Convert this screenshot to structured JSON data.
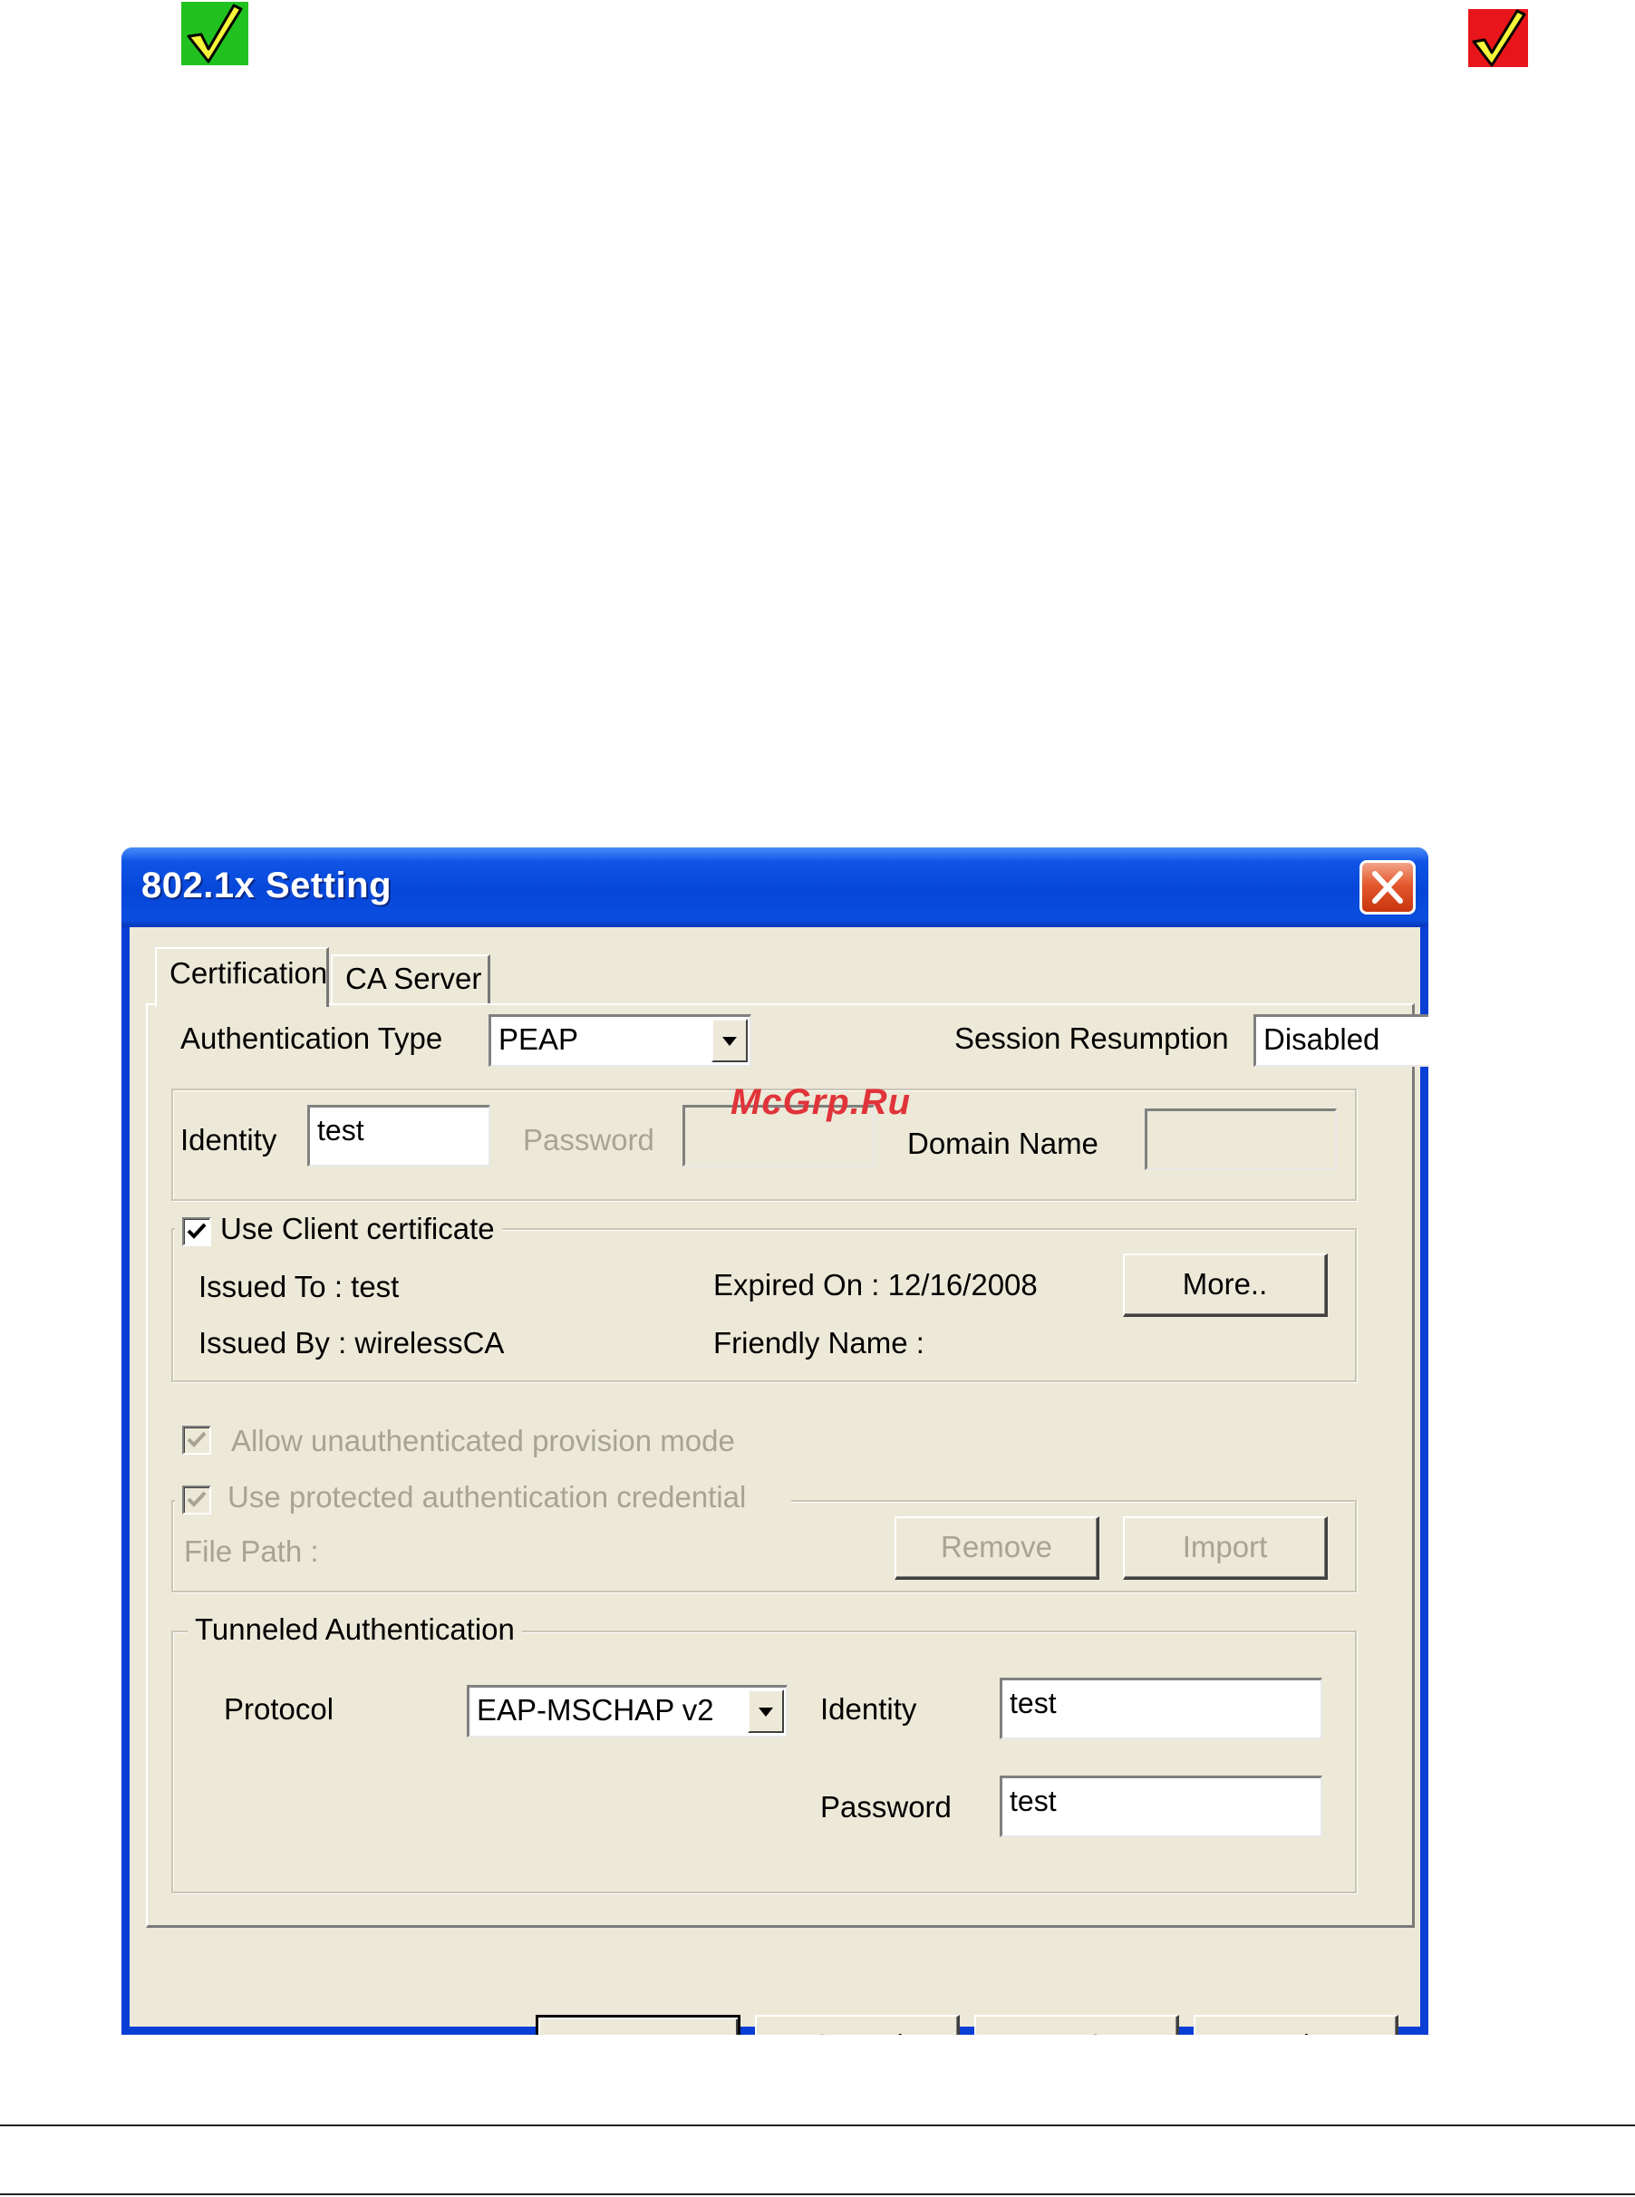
{
  "decorations": {
    "green_check_icon": "check-icon",
    "red_check_icon": "check-icon",
    "green_color": "#21c21f",
    "red_color": "#e8161a",
    "watermark": "McGrp.Ru"
  },
  "dialog": {
    "title": "802.1x Setting",
    "close_icon": "close-icon",
    "tabs": [
      {
        "label": "Certification",
        "selected": true
      },
      {
        "label": "CA Server",
        "selected": false
      }
    ],
    "authentication_type": {
      "label": "Authentication Type",
      "value": "PEAP"
    },
    "session_resumption": {
      "label": "Session Resumption",
      "value": "Disabled"
    },
    "identity": {
      "label": "Identity",
      "value": "test"
    },
    "password": {
      "label": "Password",
      "value": ""
    },
    "domain_name": {
      "label": "Domain Name",
      "value": ""
    },
    "client_certificate": {
      "label": "Use Client certificate",
      "checked": true,
      "issued_to": "Issued To : test",
      "issued_by": "Issued By : wirelessCA",
      "expired_on": "Expired On : 12/16/2008",
      "friendly_name": "Friendly Name :",
      "more_button": "More.."
    },
    "allow_unauthenticated": {
      "label": "Allow unauthenticated provision mode",
      "checked": true,
      "enabled": false
    },
    "protected_credential": {
      "label": "Use protected authentication credential",
      "checked": true,
      "enabled": false,
      "file_path_label": "File Path :",
      "remove_button": "Remove",
      "import_button": "Import"
    },
    "tunneled": {
      "legend": "Tunneled Authentication",
      "protocol_label": "Protocol",
      "protocol_value": "EAP-MSCHAP v2",
      "identity_label": "Identity",
      "identity_value": "test",
      "password_label": "Password",
      "password_value": "test"
    },
    "buttons": {
      "ok": "OK",
      "cancel": "Cancel",
      "apply": "Apply",
      "help": "Help"
    }
  }
}
